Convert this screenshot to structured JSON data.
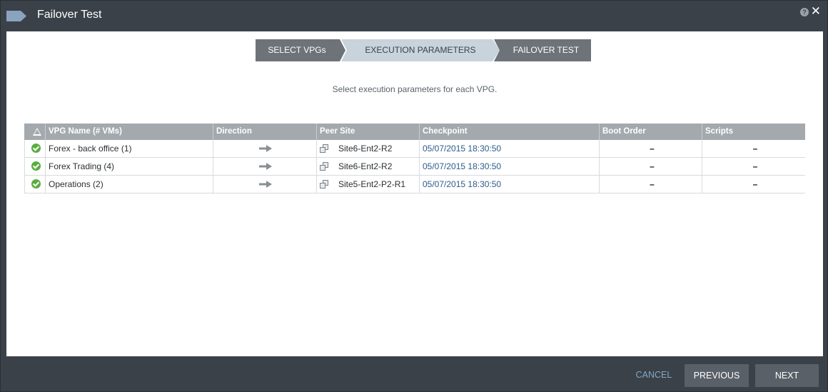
{
  "window": {
    "title": "Failover Test"
  },
  "wizard": {
    "steps": [
      {
        "label": "SELECT VPGs",
        "state": "done"
      },
      {
        "label": "EXECUTION PARAMETERS",
        "state": "active"
      },
      {
        "label": "FAILOVER TEST",
        "state": "pending"
      }
    ]
  },
  "instruction": "Select execution parameters for each VPG.",
  "table": {
    "columns": [
      "VPG Name (# VMs)",
      "Direction",
      "Peer Site",
      "Checkpoint",
      "Boot Order",
      "Scripts"
    ],
    "rows": [
      {
        "status": "ok",
        "name": "Forex - back office (1)",
        "direction": "right-arrow",
        "peer_site": "Site6-Ent2-R2",
        "checkpoint": "05/07/2015 18:30:50",
        "boot_order": "–",
        "scripts": "–"
      },
      {
        "status": "ok",
        "name": "Forex Trading (4)",
        "direction": "right-arrow",
        "peer_site": "Site6-Ent2-R2",
        "checkpoint": "05/07/2015 18:30:50",
        "boot_order": "–",
        "scripts": "–"
      },
      {
        "status": "ok",
        "name": "Operations (2)",
        "direction": "right-arrow",
        "peer_site": "Site5-Ent2-P2-R1",
        "checkpoint": "05/07/2015 18:30:50",
        "boot_order": "–",
        "scripts": "–"
      }
    ]
  },
  "footer": {
    "cancel": "CANCEL",
    "previous": "PREVIOUS",
    "next": "NEXT"
  },
  "colors": {
    "frame": "#3b4148",
    "step_active": "#c8d3dc",
    "step_inactive": "#6d7379",
    "status_ok": "#5aad3e",
    "checkpoint_link": "#2d5b8a",
    "cancel_link": "#7fa8c4"
  }
}
